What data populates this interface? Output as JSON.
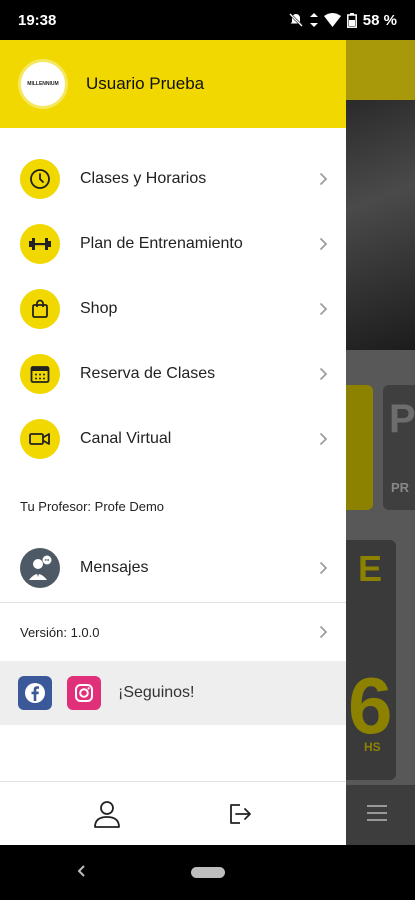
{
  "status_bar": {
    "time": "19:38",
    "battery": "58 %"
  },
  "drawer": {
    "logo_text": "MILLENNIUM",
    "user_name": "Usuario Prueba",
    "menu": [
      {
        "label": "Clases y Horarios",
        "icon": "clock-icon"
      },
      {
        "label": "Plan de Entrenamiento",
        "icon": "dumbbell-icon"
      },
      {
        "label": "Shop",
        "icon": "shopping-bag-icon"
      },
      {
        "label": "Reserva de Clases",
        "icon": "calendar-icon"
      },
      {
        "label": "Canal Virtual",
        "icon": "video-camera-icon"
      }
    ],
    "professor_label": "Tu Profesor: Profe Demo",
    "messages_label": "Mensajes",
    "version_label": "Versión: 1.0.0",
    "social_label": "¡Seguinos!"
  },
  "background_app": {
    "card_letter": "P",
    "card_text": "PR",
    "promo_letter": "E",
    "promo_number": "6",
    "promo_suffix": "HS"
  },
  "colors": {
    "accent": "#f0d800",
    "facebook": "#3b5998",
    "instagram": "#e0307a",
    "avatar": "#4d5964"
  }
}
